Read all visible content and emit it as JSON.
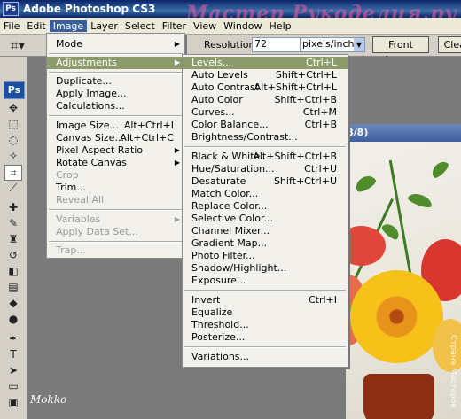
{
  "app": {
    "title": "Adobe Photoshop CS3",
    "icon": "ps-icon"
  },
  "watermark": "Мастер Рукоделия.ру",
  "menubar": [
    "File",
    "Edit",
    "Image",
    "Layer",
    "Select",
    "Filter",
    "View",
    "Window",
    "Help"
  ],
  "options": {
    "resolution_label": "Resolution:",
    "resolution_value": "72",
    "units": "pixels/inch",
    "front_image": "Front Image",
    "clear": "Clear"
  },
  "toolbox": {
    "badge": "Ps"
  },
  "document": {
    "title_suffix": "8/8)"
  },
  "image_menu": [
    {
      "label": "Mode",
      "arrow": true
    },
    {
      "label": "Adjustments",
      "arrow": true,
      "highlight": true
    },
    {
      "label": "Duplicate..."
    },
    {
      "label": "Apply Image..."
    },
    {
      "label": "Calculations..."
    },
    {
      "label": "Image Size...",
      "shortcut": "Alt+Ctrl+I"
    },
    {
      "label": "Canvas Size...",
      "shortcut": "Alt+Ctrl+C"
    },
    {
      "label": "Pixel Aspect Ratio",
      "arrow": true
    },
    {
      "label": "Rotate Canvas",
      "arrow": true
    },
    {
      "label": "Crop",
      "disabled": true
    },
    {
      "label": "Trim..."
    },
    {
      "label": "Reveal All",
      "disabled": true
    },
    {
      "label": "Variables",
      "disabled": true,
      "arrow": true
    },
    {
      "label": "Apply Data Set...",
      "disabled": true
    },
    {
      "label": "Trap...",
      "disabled": true
    }
  ],
  "adjustments_menu": [
    {
      "label": "Levels...",
      "shortcut": "Ctrl+L",
      "highlight": true
    },
    {
      "label": "Auto Levels",
      "shortcut": "Shift+Ctrl+L"
    },
    {
      "label": "Auto Contrast",
      "shortcut": "Alt+Shift+Ctrl+L"
    },
    {
      "label": "Auto Color",
      "shortcut": "Shift+Ctrl+B"
    },
    {
      "label": "Curves...",
      "shortcut": "Ctrl+M"
    },
    {
      "label": "Color Balance...",
      "shortcut": "Ctrl+B"
    },
    {
      "label": "Brightness/Contrast..."
    },
    {
      "label": "Black & White...",
      "shortcut": "Alt+Shift+Ctrl+B"
    },
    {
      "label": "Hue/Saturation...",
      "shortcut": "Ctrl+U"
    },
    {
      "label": "Desaturate",
      "shortcut": "Shift+Ctrl+U"
    },
    {
      "label": "Match Color..."
    },
    {
      "label": "Replace Color..."
    },
    {
      "label": "Selective Color..."
    },
    {
      "label": "Channel Mixer..."
    },
    {
      "label": "Gradient Map..."
    },
    {
      "label": "Photo Filter..."
    },
    {
      "label": "Shadow/Highlight..."
    },
    {
      "label": "Exposure..."
    },
    {
      "label": "Invert",
      "shortcut": "Ctrl+I"
    },
    {
      "label": "Equalize"
    },
    {
      "label": "Threshold..."
    },
    {
      "label": "Posterize..."
    },
    {
      "label": "Variations..."
    }
  ],
  "signature": "Mokko",
  "stamp": "Страна Мастеров",
  "colors": {
    "menu_highlight": "#8c9b6a",
    "title_bar": "#0a246a"
  }
}
